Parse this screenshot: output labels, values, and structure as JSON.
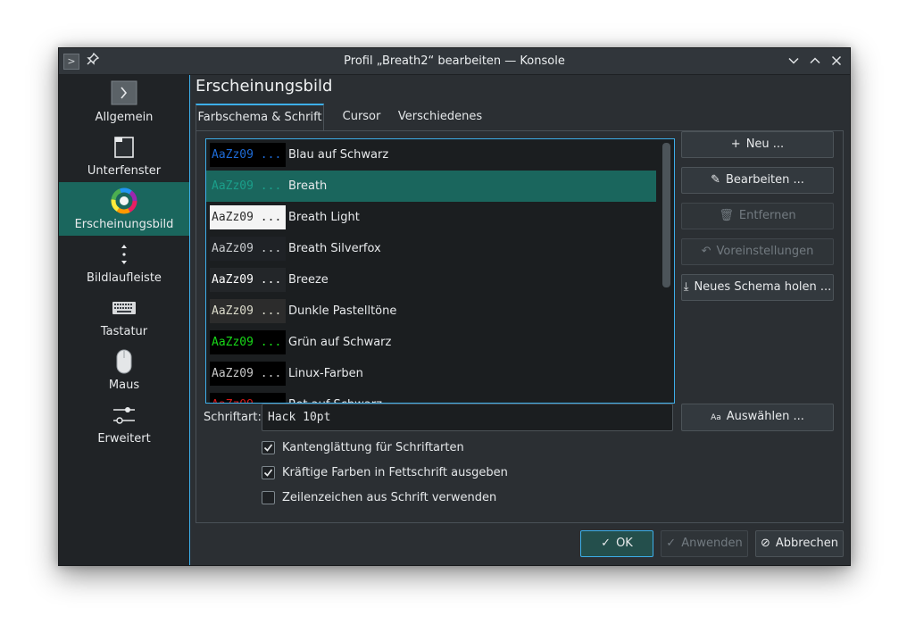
{
  "window": {
    "title": "Profil „Breath2“ bearbeiten — Konsole",
    "app_icon": "konsole-icon",
    "controls": [
      "minimize-icon",
      "maximize-icon",
      "close-icon"
    ]
  },
  "sidebar": {
    "items": [
      {
        "label": "Allgemein",
        "icon": "terminal-icon"
      },
      {
        "label": "Unterfenster",
        "icon": "tab-icon"
      },
      {
        "label": "Erscheinungsbild",
        "icon": "color-wheel-icon",
        "active": true
      },
      {
        "label": "Bildlaufleiste",
        "icon": "scrollbar-icon"
      },
      {
        "label": "Tastatur",
        "icon": "keyboard-icon"
      },
      {
        "label": "Maus",
        "icon": "mouse-icon"
      },
      {
        "label": "Erweitert",
        "icon": "sliders-icon"
      }
    ]
  },
  "page": {
    "title": "Erscheinungsbild",
    "tabs": [
      {
        "label": "Farbschema & Schrift",
        "active": true
      },
      {
        "label": "Cursor"
      },
      {
        "label": "Verschiedenes"
      }
    ]
  },
  "schemes": {
    "preview_text": "AaZz09 ...",
    "items": [
      {
        "name": "Blau auf Schwarz",
        "bg": "#000000",
        "fg": "#1e6cd8"
      },
      {
        "name": "Breath",
        "bg": "#1a665d",
        "fg": "#1a9f8a",
        "selected": true
      },
      {
        "name": "Breath Light",
        "bg": "#f4f4f4",
        "fg": "#2a2a2a"
      },
      {
        "name": "Breath Silverfox",
        "bg": "#1f2226",
        "fg": "#c8cbce"
      },
      {
        "name": "Breeze",
        "bg": "#232629",
        "fg": "#ffffff"
      },
      {
        "name": "Dunkle Pastelltöne",
        "bg": "#2c2c2c",
        "fg": "#dcdccc"
      },
      {
        "name": "Grün auf Schwarz",
        "bg": "#000000",
        "fg": "#18d818"
      },
      {
        "name": "Linux-Farben",
        "bg": "#000000",
        "fg": "#c8c8c8"
      },
      {
        "name": "Rot auf Schwarz",
        "bg": "#000000",
        "fg": "#d81818"
      }
    ]
  },
  "buttons": {
    "new": "Neu ...",
    "edit": "Bearbeiten ...",
    "remove": "Entfernen",
    "defaults": "Voreinstellungen",
    "get_new": "Neues Schema holen ...",
    "choose": "Auswählen ...",
    "ok": "OK",
    "apply": "Anwenden",
    "cancel": "Abbrechen"
  },
  "font": {
    "label": "Schriftart:",
    "value": "Hack 10pt"
  },
  "options": [
    {
      "label": "Kantenglättung für Schriftarten",
      "checked": true
    },
    {
      "label": "Kräftige Farben in Fettschrift ausgeben",
      "checked": true
    },
    {
      "label": "Zeilenzeichen aus Schrift verwenden",
      "checked": false
    }
  ],
  "colors": {
    "accent": "#3daee9",
    "selection": "#1a665d",
    "window_bg": "#2b2f33"
  }
}
